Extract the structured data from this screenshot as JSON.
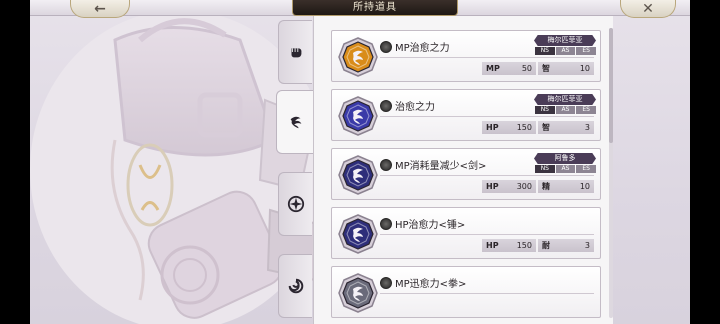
{
  "header": {
    "title": "所持道具",
    "back_icon": "←",
    "close_icon": "✕"
  },
  "tabs": [
    {
      "icon": "fist-icon"
    },
    {
      "icon": "swirl-icon"
    },
    {
      "icon": "emblem-icon"
    },
    {
      "icon": "vortex-icon"
    }
  ],
  "items": [
    {
      "name": "MP治愈之力",
      "gem_color": "#d98c1a",
      "tag": "梅尔匹菲亚",
      "flags": [
        "NS",
        "AS",
        "ES"
      ],
      "flags_on": [
        true,
        false,
        false
      ],
      "stat1_key": "MP",
      "stat1_val": "50",
      "stat2_key": "智",
      "stat2_val": "10"
    },
    {
      "name": "治愈之力",
      "gem_color": "#3a3aa8",
      "tag": "梅尔匹菲亚",
      "flags": [
        "NS",
        "AS",
        "ES"
      ],
      "flags_on": [
        true,
        false,
        false
      ],
      "stat1_key": "HP",
      "stat1_val": "150",
      "stat2_key": "智",
      "stat2_val": "3"
    },
    {
      "name": "MP消耗量减少<剑>",
      "gem_color": "#2e2e7a",
      "tag": "阿鲁多",
      "flags": [
        "NS",
        "AS",
        "ES"
      ],
      "flags_on": [
        true,
        false,
        false
      ],
      "stat1_key": "HP",
      "stat1_val": "300",
      "stat2_key": "精",
      "stat2_val": "10"
    },
    {
      "name": "HP治愈力<锤>",
      "gem_color": "#2e2e7a",
      "tag": "",
      "flags": [],
      "flags_on": [],
      "stat1_key": "HP",
      "stat1_val": "150",
      "stat2_key": "耐",
      "stat2_val": "3"
    },
    {
      "name": "MP迅愈力<拳>",
      "gem_color": "#6a6a7a",
      "tag": "",
      "flags": [],
      "flags_on": [],
      "stat1_key": "",
      "stat1_val": "",
      "stat2_key": "",
      "stat2_val": ""
    }
  ]
}
